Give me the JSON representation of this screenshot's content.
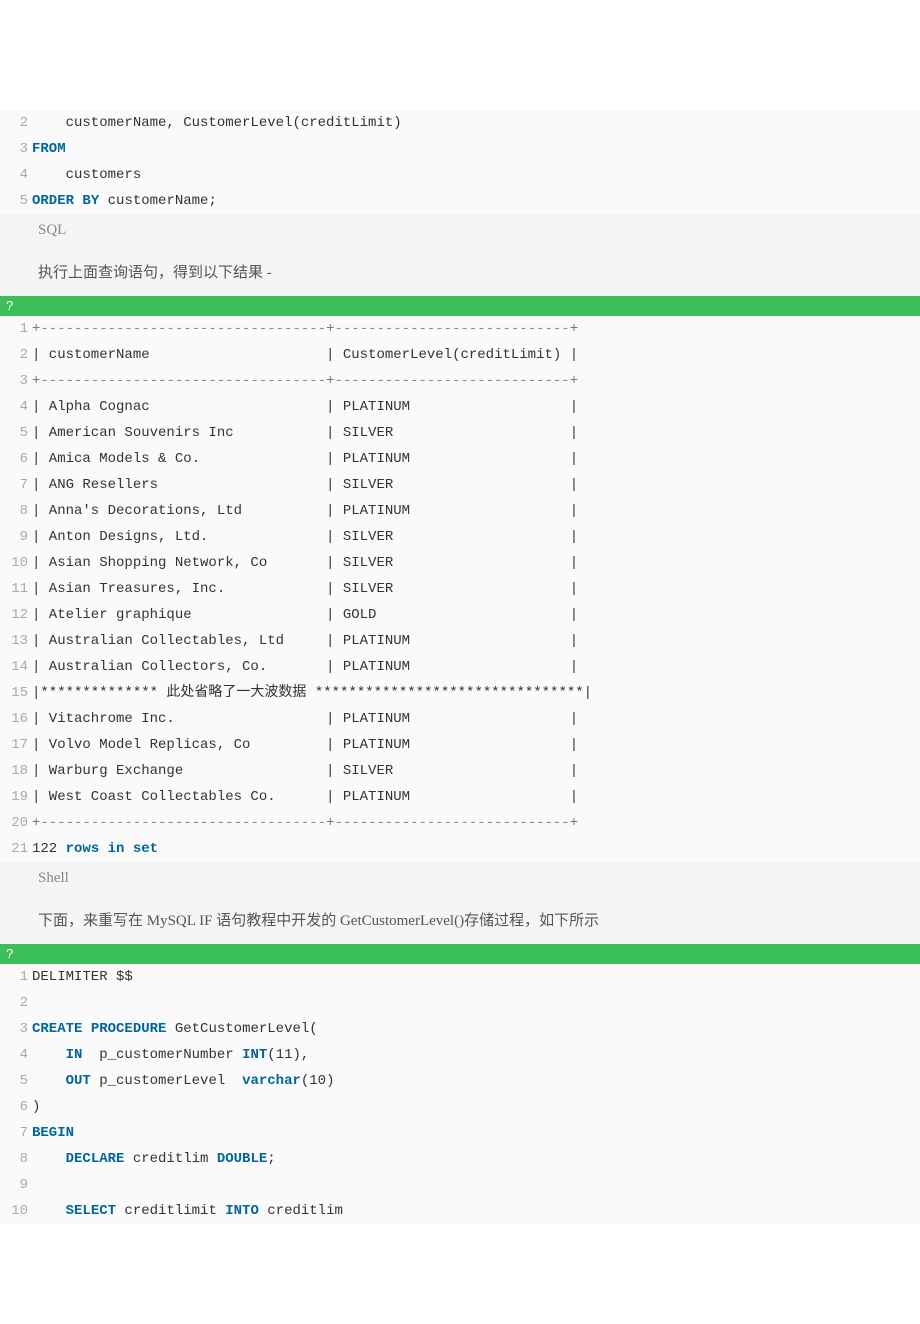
{
  "block1": {
    "lines": [
      {
        "n": "2",
        "segs": [
          {
            "t": "    customerName, CustomerLevel(creditLimit)"
          }
        ]
      },
      {
        "n": "3",
        "segs": [
          {
            "t": "FROM",
            "c": "kw"
          }
        ]
      },
      {
        "n": "4",
        "segs": [
          {
            "t": "    customers"
          }
        ]
      },
      {
        "n": "5",
        "segs": [
          {
            "t": "ORDER",
            "c": "kw"
          },
          {
            "t": " "
          },
          {
            "t": "BY",
            "c": "kw"
          },
          {
            "t": " customerName;"
          }
        ]
      }
    ],
    "lang": "SQL"
  },
  "narration1": "执行上面查询语句，得到以下结果 -",
  "greenBar": "?",
  "block2": {
    "lines": [
      {
        "n": "1",
        "segs": [
          {
            "t": "+",
            "c": "plus"
          },
          {
            "t": "----------------------------------",
            "c": "dashed"
          },
          {
            "t": "+",
            "c": "plus"
          },
          {
            "t": "----------------------------",
            "c": "dashed"
          },
          {
            "t": "+",
            "c": "plus"
          }
        ]
      },
      {
        "n": "2",
        "segs": [
          {
            "t": "| customerName                     | CustomerLevel(creditLimit) |"
          }
        ]
      },
      {
        "n": "3",
        "segs": [
          {
            "t": "+",
            "c": "plus"
          },
          {
            "t": "----------------------------------",
            "c": "dashed"
          },
          {
            "t": "+",
            "c": "plus"
          },
          {
            "t": "----------------------------",
            "c": "dashed"
          },
          {
            "t": "+",
            "c": "plus"
          }
        ]
      },
      {
        "n": "4",
        "segs": [
          {
            "t": "| Alpha Cognac                     | PLATINUM                   |"
          }
        ]
      },
      {
        "n": "5",
        "segs": [
          {
            "t": "| American Souvenirs Inc           | SILVER                     |"
          }
        ]
      },
      {
        "n": "6",
        "segs": [
          {
            "t": "| Amica Models & Co.               | PLATINUM                   |"
          }
        ]
      },
      {
        "n": "7",
        "segs": [
          {
            "t": "| ANG Resellers                    | SILVER                     |"
          }
        ]
      },
      {
        "n": "8",
        "segs": [
          {
            "t": "| Anna's Decorations, Ltd          | PLATINUM                   |"
          }
        ]
      },
      {
        "n": "9",
        "segs": [
          {
            "t": "| Anton Designs, Ltd.              | SILVER                     |"
          }
        ]
      },
      {
        "n": "10",
        "segs": [
          {
            "t": "| Asian Shopping Network, Co       | SILVER                     |"
          }
        ]
      },
      {
        "n": "11",
        "segs": [
          {
            "t": "| Asian Treasures, Inc.            | SILVER                     |"
          }
        ]
      },
      {
        "n": "12",
        "segs": [
          {
            "t": "| Atelier graphique                | GOLD                       |"
          }
        ]
      },
      {
        "n": "13",
        "segs": [
          {
            "t": "| Australian Collectables, Ltd     | PLATINUM                   |"
          }
        ]
      },
      {
        "n": "14",
        "segs": [
          {
            "t": "| Australian Collectors, Co.       | PLATINUM                   |"
          }
        ]
      },
      {
        "n": "15",
        "segs": [
          {
            "t": "|************** 此处省略了一大波数据 ********************************|"
          }
        ]
      },
      {
        "n": "16",
        "segs": [
          {
            "t": "| Vitachrome Inc.                  | PLATINUM                   |"
          }
        ]
      },
      {
        "n": "17",
        "segs": [
          {
            "t": "| Volvo Model Replicas, Co         | PLATINUM                   |"
          }
        ]
      },
      {
        "n": "18",
        "segs": [
          {
            "t": "| Warburg Exchange                 | SILVER                     |"
          }
        ]
      },
      {
        "n": "19",
        "segs": [
          {
            "t": "| West Coast Collectables Co.      | PLATINUM                   |"
          }
        ]
      },
      {
        "n": "20",
        "segs": [
          {
            "t": "+",
            "c": "plus"
          },
          {
            "t": "----------------------------------",
            "c": "dashed"
          },
          {
            "t": "+",
            "c": "plus"
          },
          {
            "t": "----------------------------",
            "c": "dashed"
          },
          {
            "t": "+",
            "c": "plus"
          }
        ]
      },
      {
        "n": "21",
        "segs": [
          {
            "t": "122 "
          },
          {
            "t": "rows",
            "c": "kw"
          },
          {
            "t": " "
          },
          {
            "t": "in",
            "c": "kw"
          },
          {
            "t": " "
          },
          {
            "t": "set",
            "c": "kw"
          }
        ]
      }
    ],
    "lang": "Shell"
  },
  "narration2": "下面，来重写在 MySQL IF 语句教程中开发的 GetCustomerLevel()存储过程，如下所示",
  "block3": {
    "lines": [
      {
        "n": "1",
        "segs": [
          {
            "t": "DELIMITER $$"
          }
        ]
      },
      {
        "n": "2",
        "segs": [
          {
            "t": ""
          }
        ]
      },
      {
        "n": "3",
        "segs": [
          {
            "t": "CREATE",
            "c": "kw"
          },
          {
            "t": " "
          },
          {
            "t": "PROCEDURE",
            "c": "kw"
          },
          {
            "t": " GetCustomerLevel("
          }
        ]
      },
      {
        "n": "4",
        "segs": [
          {
            "t": "    "
          },
          {
            "t": "IN",
            "c": "kw"
          },
          {
            "t": "  p_customerNumber "
          },
          {
            "t": "INT",
            "c": "kw"
          },
          {
            "t": "(11),"
          }
        ]
      },
      {
        "n": "5",
        "segs": [
          {
            "t": "    "
          },
          {
            "t": "OUT",
            "c": "kw"
          },
          {
            "t": " p_customerLevel  "
          },
          {
            "t": "varchar",
            "c": "kw"
          },
          {
            "t": "(10)"
          }
        ]
      },
      {
        "n": "6",
        "segs": [
          {
            "t": ")"
          }
        ]
      },
      {
        "n": "7",
        "segs": [
          {
            "t": "BEGIN",
            "c": "kw"
          }
        ]
      },
      {
        "n": "8",
        "segs": [
          {
            "t": "    "
          },
          {
            "t": "DECLARE",
            "c": "kw"
          },
          {
            "t": " creditlim "
          },
          {
            "t": "DOUBLE",
            "c": "kw"
          },
          {
            "t": ";"
          }
        ]
      },
      {
        "n": "9",
        "segs": [
          {
            "t": ""
          }
        ]
      },
      {
        "n": "10",
        "segs": [
          {
            "t": "    "
          },
          {
            "t": "SELECT",
            "c": "kw"
          },
          {
            "t": " creditlimit "
          },
          {
            "t": "INTO",
            "c": "kw"
          },
          {
            "t": " creditlim"
          }
        ]
      }
    ]
  }
}
